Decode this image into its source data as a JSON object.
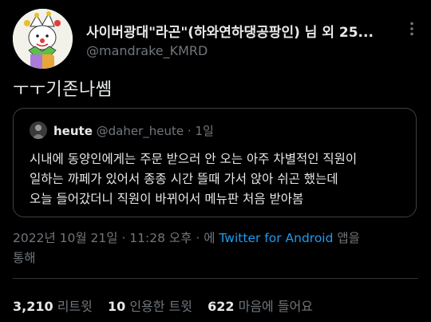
{
  "tweet": {
    "author_name": "사이버광대\"라곤\"(하와연하댕공팡인) 님 외 25...",
    "author_handle": "@mandrake_KMRD",
    "text": "ㅜㅜ기존나쎔",
    "more_icon": "more-dots-icon"
  },
  "quote": {
    "name": "heute",
    "handle": "@daher_heute",
    "separator": "·",
    "time": "1일",
    "lines": [
      "시내에 동양인에게는 주문 받으러 안 오는 아주 차별적인 직원이",
      "일하는 까페가 있어서 종종 시간 뜰때 가서 앉아 쉬곤 했는데",
      "오늘 들어갔더니 직원이 바뀌어서 메뉴판 처음 받아봄"
    ]
  },
  "meta": {
    "timestamp": "2022년 10월 21일 · 11:28 오후",
    "separator": " · 에 ",
    "source": "Twitter for Android",
    "suffix": " 앱을",
    "suffix_line2": "통해"
  },
  "stats": {
    "retweets_count": "3,210",
    "retweets_label": "리트윗",
    "quotes_count": "10",
    "quotes_label": "인용한 트윗",
    "likes_count": "622",
    "likes_label": "마음에 들어요"
  },
  "colors": {
    "background": "#000000",
    "text": "#e7e9ea",
    "secondary": "#71767b",
    "link": "#1d9bf0",
    "border": "#2f3336"
  }
}
